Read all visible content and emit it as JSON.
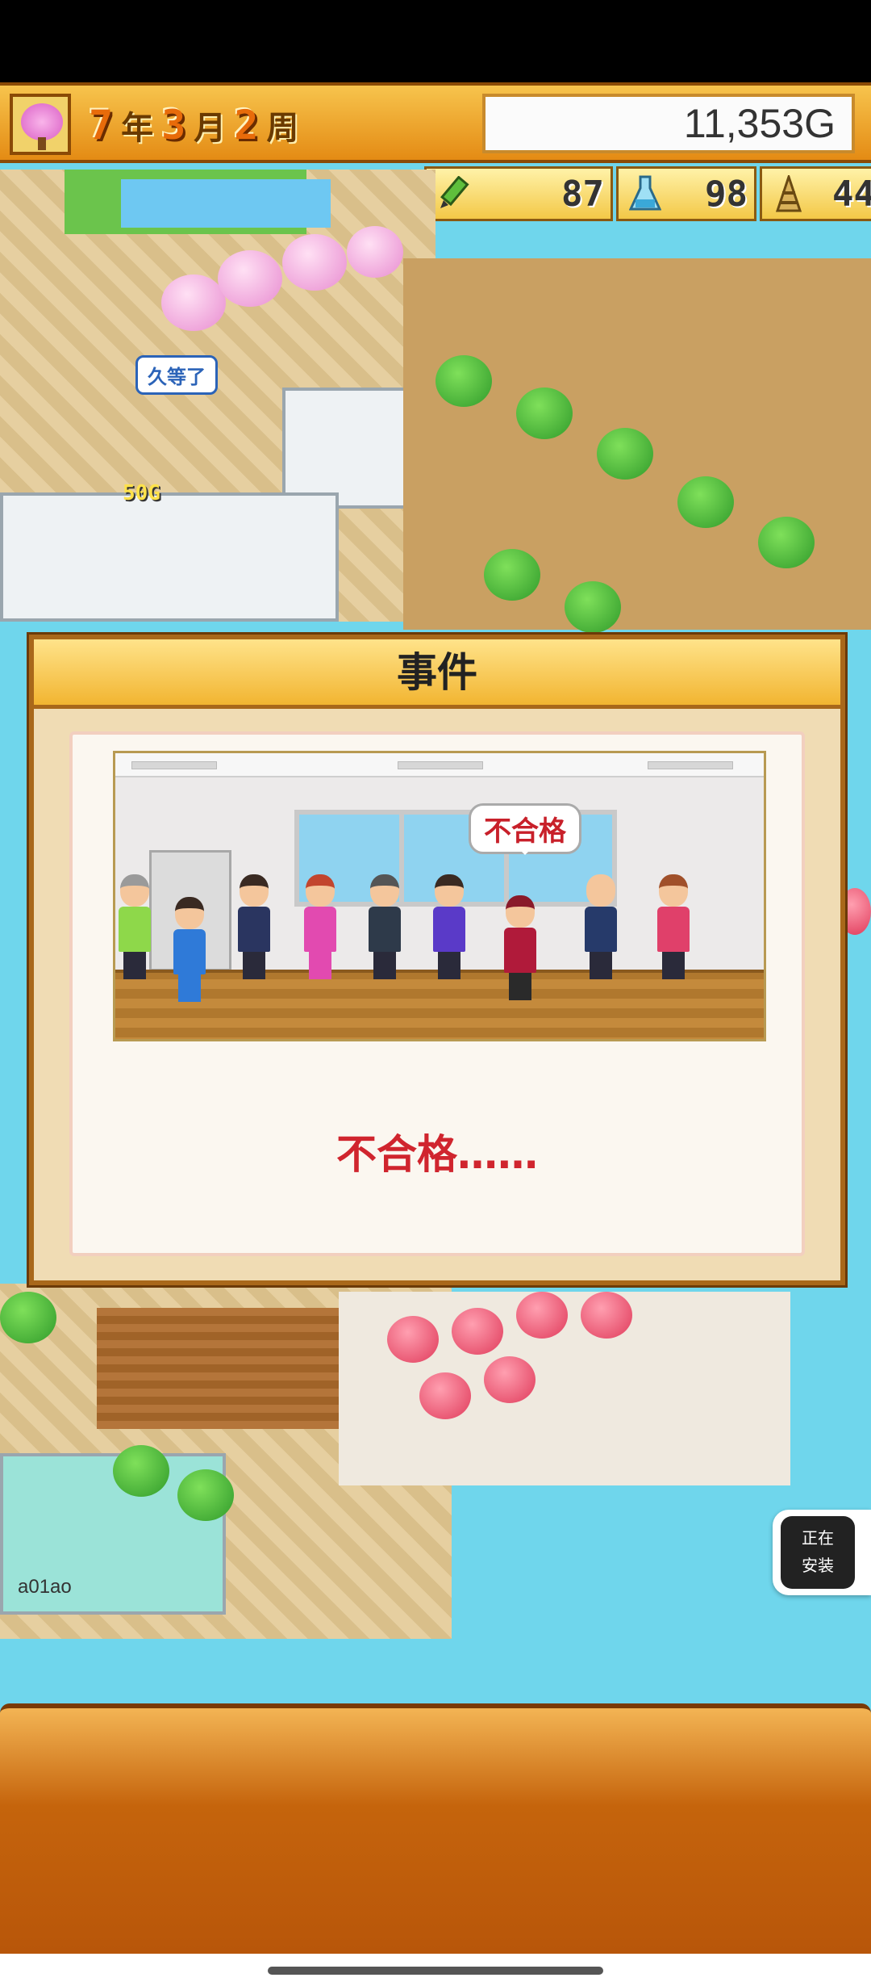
{
  "hud": {
    "year": "7",
    "year_unit": "年",
    "month": "3",
    "month_unit": "月",
    "week": "2",
    "week_unit": "周",
    "money": "11,353G",
    "stats": [
      {
        "icon": "pencil-icon",
        "value": "87"
      },
      {
        "icon": "flask-icon",
        "value": "98"
      },
      {
        "icon": "tower-icon",
        "value": "44"
      }
    ]
  },
  "world": {
    "npc_bubble": "久等了",
    "coin_label": "50G",
    "watermark": "a01ao"
  },
  "dialog": {
    "title": "事件",
    "scene_bubble": "不合格",
    "result_text": "不合格……"
  },
  "install_badge": {
    "line1": "正在",
    "line2": "安装"
  },
  "colors": {
    "hud_orange": "#e48b14",
    "dialog_border": "#a9681a",
    "result_red": "#d0252e",
    "water": "#6fd6ec"
  }
}
